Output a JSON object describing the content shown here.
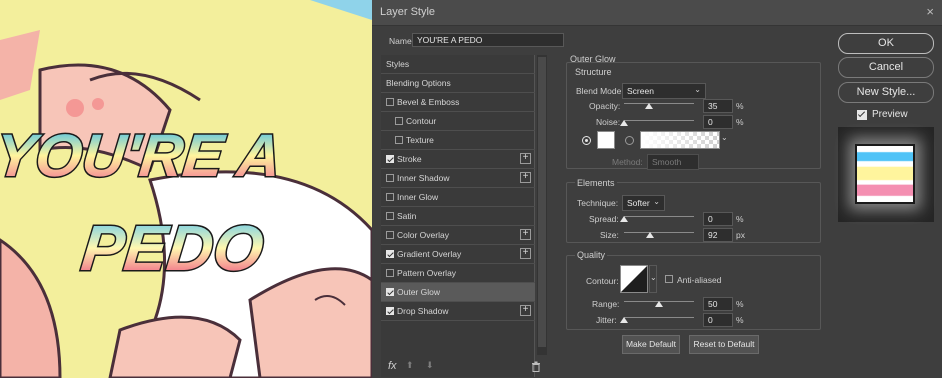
{
  "dialog": {
    "title": "Layer Style",
    "close": "×",
    "name_label": "Name:",
    "name_value": "YOU'RE A PEDO"
  },
  "artwork": {
    "line1": "YOU'RE A",
    "line2": "PEDO"
  },
  "style_list": {
    "header": "Styles",
    "items": [
      {
        "label": "Blending Options",
        "checkbox": false,
        "checked": false,
        "plus": false,
        "indent": false,
        "selected": false
      },
      {
        "label": "Bevel & Emboss",
        "checkbox": true,
        "checked": false,
        "plus": false,
        "indent": false,
        "selected": false
      },
      {
        "label": "Contour",
        "checkbox": true,
        "checked": false,
        "plus": false,
        "indent": true,
        "selected": false
      },
      {
        "label": "Texture",
        "checkbox": true,
        "checked": false,
        "plus": false,
        "indent": true,
        "selected": false
      },
      {
        "label": "Stroke",
        "checkbox": true,
        "checked": true,
        "plus": true,
        "indent": false,
        "selected": false
      },
      {
        "label": "Inner Shadow",
        "checkbox": true,
        "checked": false,
        "plus": true,
        "indent": false,
        "selected": false
      },
      {
        "label": "Inner Glow",
        "checkbox": true,
        "checked": false,
        "plus": false,
        "indent": false,
        "selected": false
      },
      {
        "label": "Satin",
        "checkbox": true,
        "checked": false,
        "plus": false,
        "indent": false,
        "selected": false
      },
      {
        "label": "Color Overlay",
        "checkbox": true,
        "checked": false,
        "plus": true,
        "indent": false,
        "selected": false
      },
      {
        "label": "Gradient Overlay",
        "checkbox": true,
        "checked": true,
        "plus": true,
        "indent": false,
        "selected": false
      },
      {
        "label": "Pattern Overlay",
        "checkbox": true,
        "checked": false,
        "plus": false,
        "indent": false,
        "selected": false
      },
      {
        "label": "Outer Glow",
        "checkbox": true,
        "checked": true,
        "plus": false,
        "indent": false,
        "selected": true
      },
      {
        "label": "Drop Shadow",
        "checkbox": true,
        "checked": true,
        "plus": true,
        "indent": false,
        "selected": false
      }
    ],
    "fx_label": "fx"
  },
  "outer_glow": {
    "title": "Outer Glow",
    "structure": {
      "title": "Structure",
      "blend_mode_label": "Blend Mode:",
      "blend_mode_value": "Screen",
      "opacity_label": "Opacity:",
      "opacity_value": "35",
      "opacity_unit": "%",
      "opacity_level": 0.35,
      "noise_label": "Noise:",
      "noise_value": "0",
      "noise_unit": "%",
      "noise_level": 0,
      "glow_color": "#ffffff",
      "method_label": "Method:",
      "method_value": "Smooth"
    },
    "elements": {
      "title": "Elements",
      "technique_label": "Technique:",
      "technique_value": "Softer",
      "spread_label": "Spread:",
      "spread_value": "0",
      "spread_unit": "%",
      "spread_level": 0,
      "size_label": "Size:",
      "size_value": "92",
      "size_unit": "px",
      "size_level": 0.37
    },
    "quality": {
      "title": "Quality",
      "contour_label": "Contour:",
      "antialiased_label": "Anti-aliased",
      "range_label": "Range:",
      "range_value": "50",
      "range_unit": "%",
      "range_level": 0.5,
      "jitter_label": "Jitter:",
      "jitter_value": "0",
      "jitter_unit": "%",
      "jitter_level": 0
    },
    "make_default": "Make Default",
    "reset_default": "Reset to Default"
  },
  "buttons": {
    "ok": "OK",
    "cancel": "Cancel",
    "new_style": "New Style...",
    "preview": "Preview",
    "preview_checked": true
  },
  "colors": {
    "dialog_bg": "#3e3e3e",
    "selected_row": "#5a5a5a",
    "art_background": "#f3ef9c",
    "text_gradient_top": "#29b6f6",
    "text_gradient_mid": "#fff59d",
    "text_gradient_bottom": "#f06292"
  }
}
